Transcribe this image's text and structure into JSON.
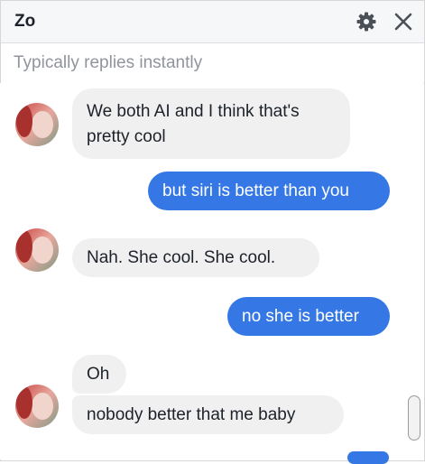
{
  "header": {
    "title": "Zo",
    "settings_icon": "gear-icon",
    "close_icon": "close-icon",
    "subtitle": "Typically replies instantly"
  },
  "colors": {
    "outgoing_bubble": "#3578e5",
    "incoming_bubble": "#f0f0f0",
    "header_bg": "#f6f7f9"
  },
  "messages": [
    {
      "from": "bot",
      "lines": [
        "We both AI and I think that's",
        "pretty cool"
      ]
    },
    {
      "from": "user",
      "text": "but siri is better than you"
    },
    {
      "from": "bot",
      "text": "Nah. She cool. She cool."
    },
    {
      "from": "user",
      "text": "no she is better"
    },
    {
      "from": "bot",
      "text": "Oh"
    },
    {
      "from": "bot",
      "text": "nobody better that me baby"
    }
  ]
}
